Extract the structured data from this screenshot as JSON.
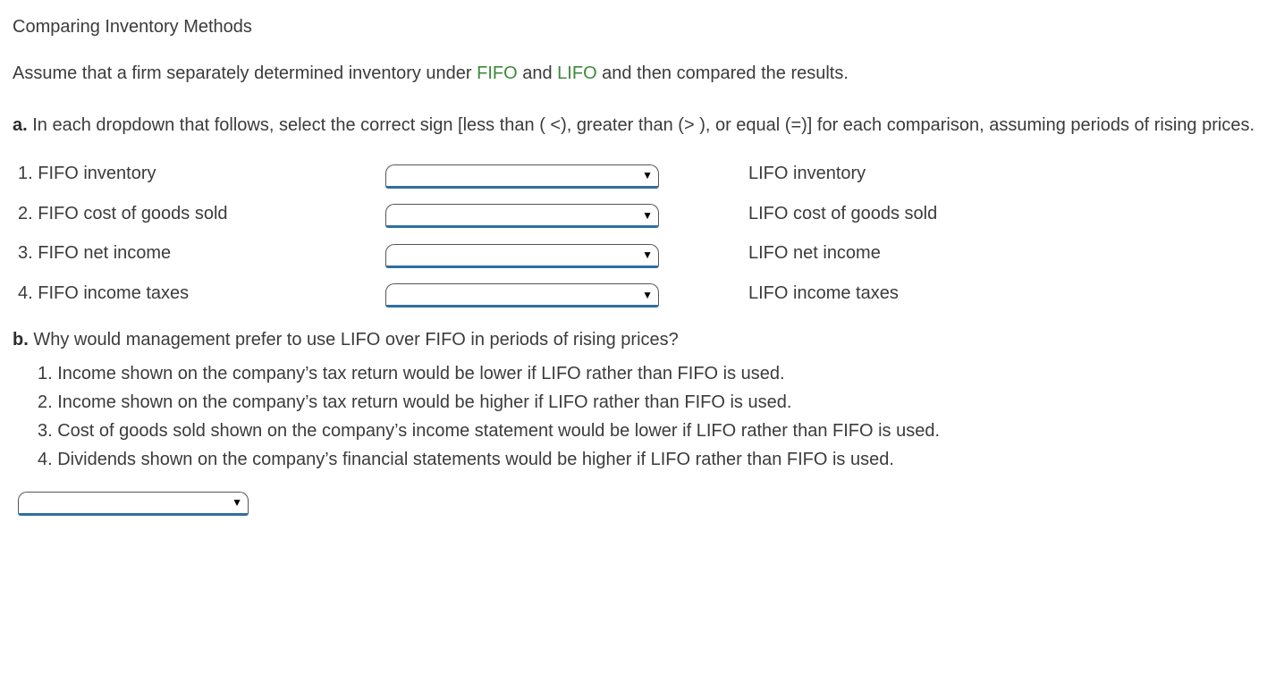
{
  "title": "Comparing Inventory Methods",
  "intro_pre": "Assume that a firm separately determined inventory under ",
  "intro_term1": "FIFO",
  "intro_mid1": " and ",
  "intro_term2": "LIFO",
  "intro_post": " and then compared the results.",
  "part_a": {
    "letter": "a.",
    "question": " In each dropdown that follows, select the correct sign [less than ( <), greater than (> ), or equal (=)] for each comparison, assuming periods of rising prices."
  },
  "comparisons": [
    {
      "left": "1. FIFO inventory",
      "right": "LIFO inventory"
    },
    {
      "left": "2. FIFO cost of goods sold",
      "right": "LIFO cost of goods sold"
    },
    {
      "left": "3. FIFO net income",
      "right": "LIFO net income"
    },
    {
      "left": "4. FIFO income taxes",
      "right": "LIFO income taxes"
    }
  ],
  "part_b": {
    "letter": "b.",
    "question": " Why would management prefer to use LIFO over FIFO in periods of rising prices?"
  },
  "answers": [
    "1. Income shown on the company’s tax return would be lower if LIFO rather than FIFO is used.",
    "2. Income shown on the company’s tax return would be higher if LIFO rather than FIFO is used.",
    "3. Cost of goods sold shown on the company’s income statement would be lower if LIFO rather than FIFO is used.",
    "4. Dividends shown on the company’s financial statements would be higher if LIFO rather than FIFO is used."
  ]
}
